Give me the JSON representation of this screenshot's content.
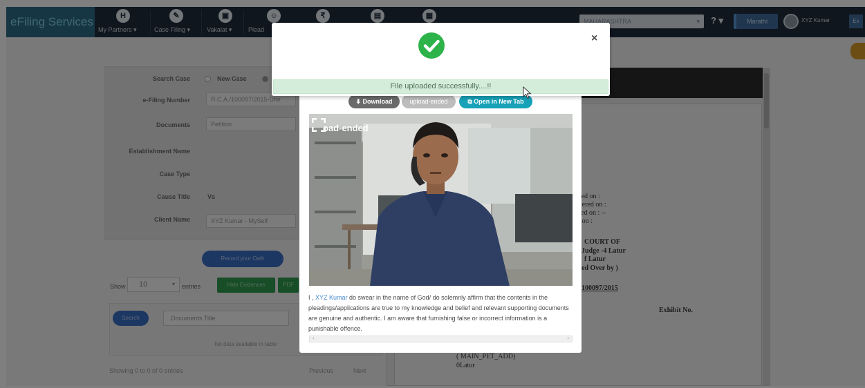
{
  "navbar": {
    "brand": "eFiling Services",
    "menu": [
      {
        "label": "My Partners ▾",
        "icon": "partners-icon",
        "glyph": "H"
      },
      {
        "label": "Case Filing ▾",
        "icon": "pen-icon",
        "glyph": "✎"
      },
      {
        "label": "Vakalat ▾",
        "icon": "vakalat-icon",
        "glyph": "▣"
      },
      {
        "label": "Plead",
        "icon": "plead-icon",
        "glyph": "☺"
      },
      {
        "label": "",
        "icon": "fee-icon",
        "glyph": "₹"
      },
      {
        "label": "",
        "icon": "document-icon",
        "glyph": "▤"
      },
      {
        "label": "",
        "icon": "calendar-icon",
        "glyph": "▦"
      }
    ],
    "court_select": "MAHARASHTRA",
    "help": "? ▾",
    "language": "Marathi",
    "user": "XYZ Kumar",
    "exit": "Ex"
  },
  "form": {
    "search_case_label": "Search Case",
    "new_case_label": "New Case",
    "efiling_number_label": "e-Filing Number",
    "efiling_number_value": "R.C.A./100097/2015-Dhir",
    "documents_label": "Documents",
    "documents_value": "Petition",
    "establishment_label": "Establishment Name",
    "case_type_label": "Case Type",
    "cause_title_label": "Cause Title",
    "cause_title_value": "Vs",
    "client_name_label": "Client Name",
    "client_name_value": "XYZ Kumar - MySelf"
  },
  "record_button": "Record your Oath",
  "table": {
    "show_label": "Show",
    "page_size": "10",
    "entries_label": "entries",
    "hide_button": "Hide Evidences",
    "pdf_button": "PDF",
    "search_button": "Search",
    "title_placeholder": "Documents Title",
    "no_data": "No data available in table",
    "showing": "Showing 0 to 0 of 0 entries",
    "previous": "Previous",
    "next": "Next"
  },
  "document": {
    "lines": [
      "ited on  :",
      "stered on :",
      "ded on   :  --",
      "sion     :",
      "COURT OF",
      "Judge -4 Latur",
      "f Latur",
      "ed Over by )",
      "100097/2015",
      "Exhibit No.",
      "( MAIN_PET_ADD)",
      "0Latur"
    ]
  },
  "video_modal": {
    "download": "Download",
    "ended_badge": "upload-ended",
    "open_new_tab": "Open in New Tab",
    "video_overlay": "oad-ended",
    "oath_prefix": "I , ",
    "oath_name": "XYZ Kumar",
    "oath_text": " do swear in the name of God/ do solemnly affirm that the contents in the pleadings/applications are true to my knowledge and belief and relevant supporting documents are genuine and authentic. I am aware that furnishing false or incorrect information is a punishable offence."
  },
  "success": {
    "message": "File uploaded successfully....!!",
    "close": "×"
  },
  "colors": {
    "navbar": "#1f2d3d",
    "success_green": "#2eb34a",
    "success_bar": "#d4edda",
    "primary_blue": "#3b6fc6",
    "info_teal": "#17a2b8"
  }
}
